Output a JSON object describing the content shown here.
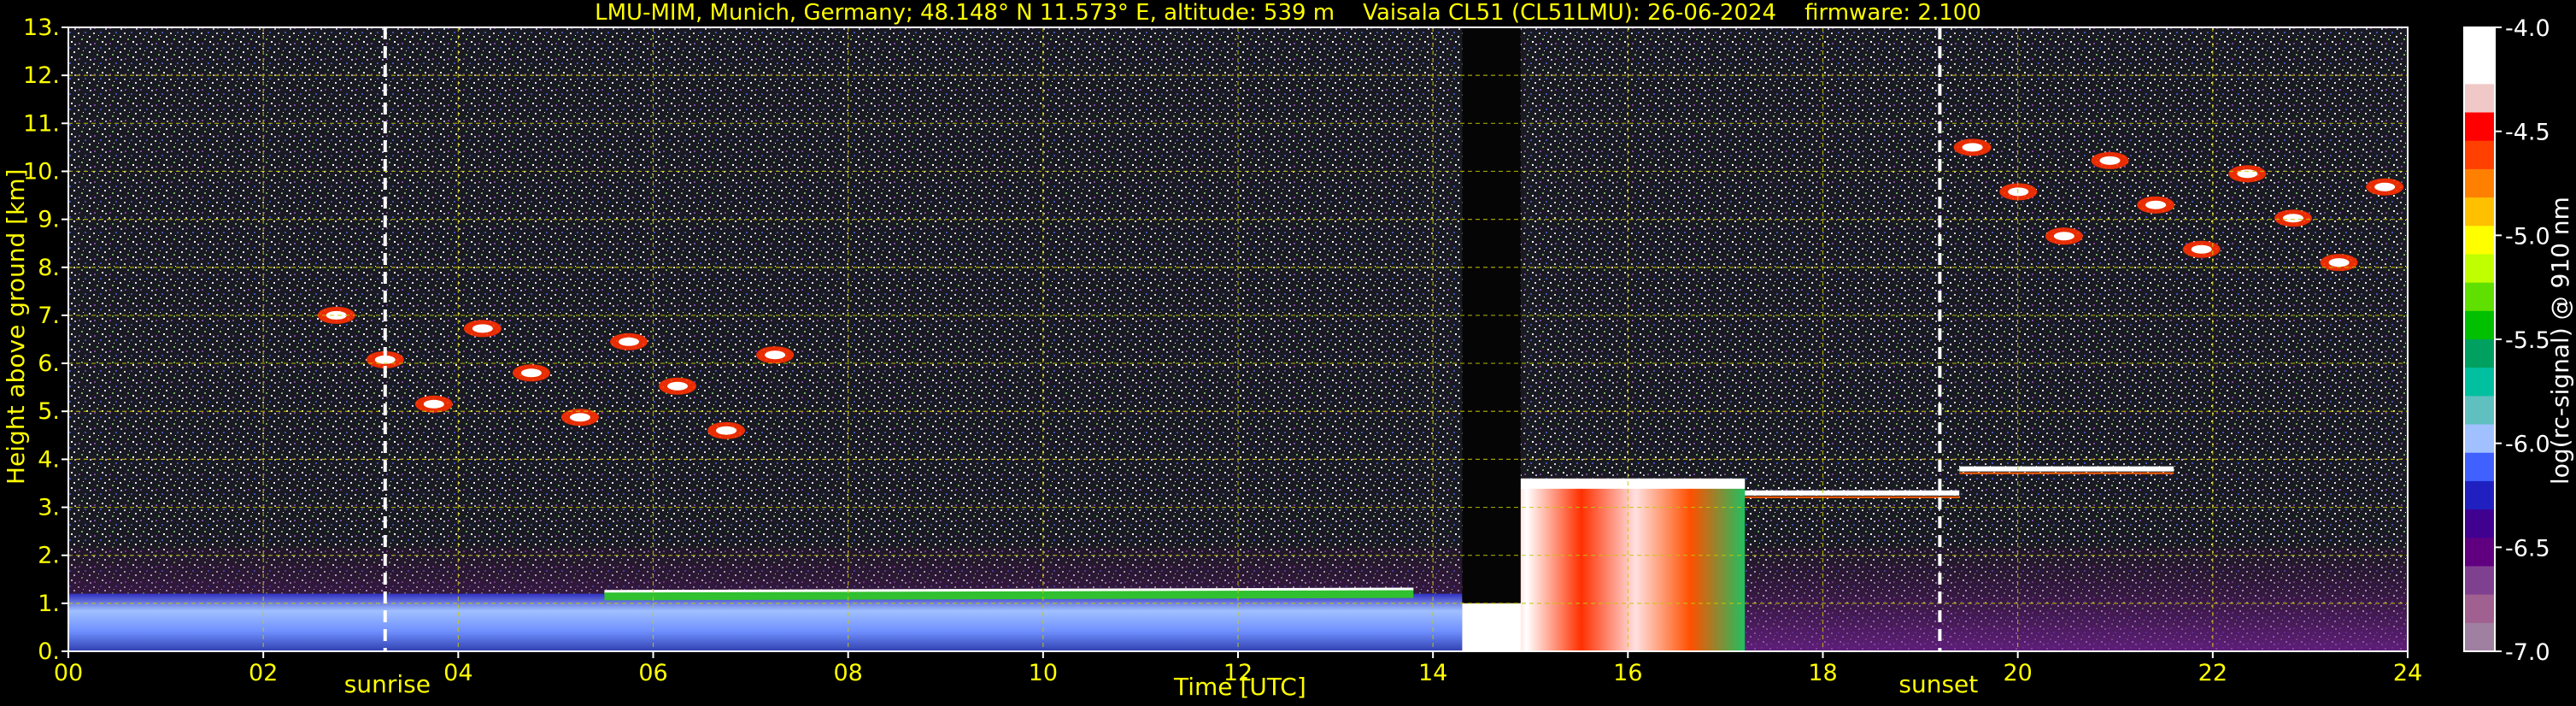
{
  "chart_data": {
    "type": "heatmap",
    "title": "LMU-MIM, Munich, Germany; 48.148° N 11.573° E, altitude: 539 m    Vaisala CL51 (CL51LMU): 26-06-2024    firmware: 2.100",
    "xlabel": "Time [UTC]",
    "ylabel": "Height above ground [km]",
    "xlim": [
      0,
      24
    ],
    "ylim": [
      0,
      13
    ],
    "x_ticks": [
      "00",
      "02",
      "04",
      "06",
      "08",
      "10",
      "12",
      "14",
      "16",
      "18",
      "20",
      "22",
      "24"
    ],
    "y_ticks": [
      "0.",
      "1.",
      "2.",
      "3.",
      "4.",
      "5.",
      "6.",
      "7.",
      "8.",
      "9.",
      "10.",
      "11.",
      "12.",
      "13."
    ],
    "grid": true,
    "events": [
      {
        "label": "sunrise",
        "time_h": 3.25
      },
      {
        "label": "sunset",
        "time_h": 19.2
      }
    ],
    "colorbar": {
      "label": "log(rc-signal) @ 910 nm",
      "range": [
        -7.0,
        -4.0
      ],
      "ticks": [
        "-4.0",
        "-4.5",
        "-5.0",
        "-5.5",
        "-6.0",
        "-6.5",
        "-7.0"
      ],
      "colors": [
        "#ffffff",
        "#ffffff",
        "#f0c8c8",
        "#ff0000",
        "#ff4000",
        "#ff8000",
        "#ffc000",
        "#ffff00",
        "#c0ff00",
        "#60e000",
        "#00c000",
        "#00a060",
        "#00c0a0",
        "#60c0c0",
        "#a0c0ff",
        "#4060ff",
        "#2020c0",
        "#400090",
        "#600080",
        "#804090",
        "#a06090",
        "#a080a0"
      ]
    },
    "features": [
      {
        "type": "boundary_layer",
        "time_range": [
          0,
          14.3
        ],
        "height_km": [
          0,
          1.2
        ]
      },
      {
        "type": "cloud",
        "time_range": [
          14.4,
          17.2
        ],
        "height_km": [
          0,
          3.6
        ]
      },
      {
        "type": "cloud_top",
        "time_range": [
          17.2,
          19.4
        ],
        "height_km": 3.3
      },
      {
        "type": "elevated_layer",
        "time_range": [
          19.4,
          21.6
        ],
        "height_km": 3.8
      },
      {
        "type": "cirrus",
        "time_range": [
          2.5,
          7.5
        ],
        "height_km": [
          4.5,
          7.0
        ]
      },
      {
        "type": "cirrus",
        "time_range": [
          19.3,
          24
        ],
        "height_km": [
          8.0,
          10.5
        ]
      },
      {
        "type": "attenuated_column",
        "time_range": [
          14.3,
          14.9
        ],
        "height_km": [
          0,
          13
        ]
      }
    ]
  }
}
